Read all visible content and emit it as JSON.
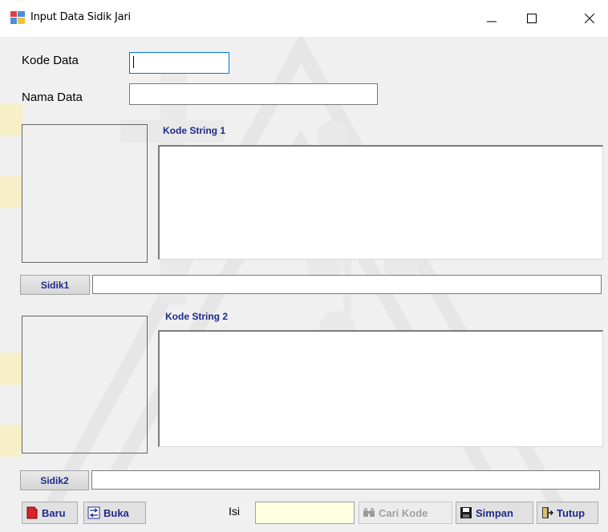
{
  "window": {
    "title": "Input Data Sidik Jari",
    "minimize_icon": "minimize-icon",
    "maximize_icon": "maximize-icon",
    "close_icon": "close-icon"
  },
  "form": {
    "kode_data_label": "Kode Data",
    "kode_data_value": "",
    "nama_data_label": "Nama Data",
    "nama_data_value": ""
  },
  "section1": {
    "kode_string_label": "Kode String 1",
    "sidik_button": "Sidik1",
    "sidik_value": ""
  },
  "section2": {
    "kode_string_label": "Kode String 2",
    "sidik_button": "Sidik2",
    "sidik_value": ""
  },
  "toolbar": {
    "baru_label": "Baru",
    "buka_label": "Buka",
    "isi_label": "Isi",
    "isi_value": "",
    "cari_kode_label": "Cari Kode",
    "simpan_label": "Simpan",
    "tutup_label": "Tutup"
  },
  "colors": {
    "label_blue": "#1f2a8c",
    "focus_border": "#0078d7",
    "isi_background": "#ffffe1"
  }
}
